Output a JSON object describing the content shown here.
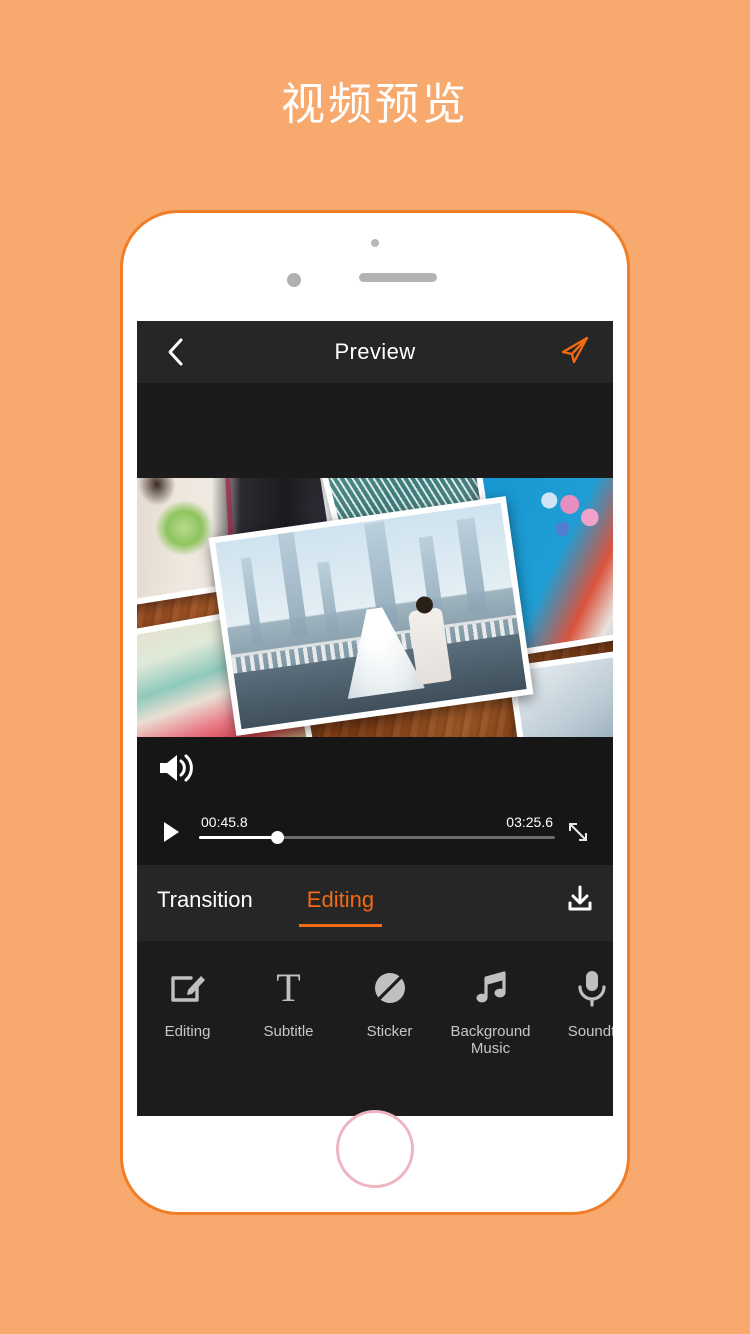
{
  "page": {
    "title": "视频预览",
    "background_color": "#f7a96e",
    "accent_color": "#f26a12"
  },
  "phone": {
    "frame_border_color": "#f07e28",
    "home_button_color": "#edb5c0"
  },
  "navbar": {
    "back_icon": "chevron-left-icon",
    "title": "Preview",
    "send_icon": "send-paper-plane-icon",
    "send_color": "#f26a12"
  },
  "player": {
    "volume_icon": "speaker-volume-icon",
    "play_icon": "play-icon",
    "current_time": "00:45.8",
    "total_time": "03:25.6",
    "progress_percent": 22,
    "expand_icon": "expand-fullscreen-icon"
  },
  "tabs": {
    "items": [
      {
        "label": "Transition",
        "active": false
      },
      {
        "label": "Editing",
        "active": true
      }
    ],
    "download_icon": "download-icon"
  },
  "tools": [
    {
      "label": "Editing",
      "icon": "pencil-square-icon"
    },
    {
      "label": "Subtitle",
      "icon": "text-t-icon"
    },
    {
      "label": "Sticker",
      "icon": "sticker-circle-slash-icon"
    },
    {
      "label": "Background\nMusic",
      "label_line1": "Background",
      "label_line2": "Music",
      "icon": "music-note-icon"
    },
    {
      "label": "Soundt",
      "icon": "microphone-icon"
    }
  ]
}
